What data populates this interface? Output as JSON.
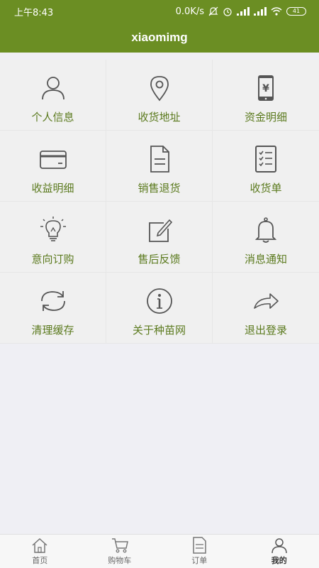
{
  "status": {
    "time": "上午8:43",
    "speed": "0.0K/s",
    "battery": "41"
  },
  "header": {
    "title": "xiaomimg"
  },
  "colors": {
    "brand": "#6b8e23",
    "label": "#5b7a1e",
    "icon": "#555555"
  },
  "menu": [
    {
      "label": "个人信息",
      "icon": "person-icon"
    },
    {
      "label": "收货地址",
      "icon": "location-pin-icon"
    },
    {
      "label": "资金明细",
      "icon": "phone-yen-icon"
    },
    {
      "label": "收益明细",
      "icon": "card-icon"
    },
    {
      "label": "销售退货",
      "icon": "document-icon"
    },
    {
      "label": "收货单",
      "icon": "checklist-icon"
    },
    {
      "label": "意向订购",
      "icon": "lightbulb-icon"
    },
    {
      "label": "售后反馈",
      "icon": "edit-icon"
    },
    {
      "label": "消息通知",
      "icon": "bell-icon"
    },
    {
      "label": "清理缓存",
      "icon": "refresh-icon"
    },
    {
      "label": "关于种苗网",
      "icon": "info-icon"
    },
    {
      "label": "退出登录",
      "icon": "share-arrow-icon"
    }
  ],
  "tabs": [
    {
      "label": "首页",
      "icon": "home-icon"
    },
    {
      "label": "购物车",
      "icon": "cart-icon"
    },
    {
      "label": "订单",
      "icon": "order-icon"
    },
    {
      "label": "我的",
      "icon": "user-icon"
    }
  ]
}
